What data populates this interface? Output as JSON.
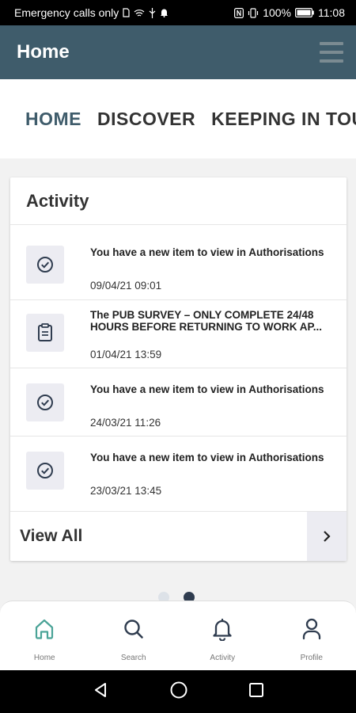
{
  "status_bar": {
    "carrier": "Emergency calls only",
    "battery": "100%",
    "time": "11:08"
  },
  "header": {
    "title": "Home",
    "menu_icon": "hamburger-icon"
  },
  "tabs": [
    {
      "label": "HOME",
      "active": true
    },
    {
      "label": "DISCOVER",
      "active": false
    },
    {
      "label": "KEEPING IN TOU",
      "active": false
    }
  ],
  "activity": {
    "title": "Activity",
    "items": [
      {
        "icon": "check-circle-icon",
        "text": "You have a new item to view in Authorisations",
        "date": "09/04/21 09:01"
      },
      {
        "icon": "clipboard-icon",
        "text": "The PUB SURVEY – ONLY COMPLETE 24/48 HOURS BEFORE RETURNING TO WORK AP...",
        "date": "01/04/21 13:59"
      },
      {
        "icon": "check-circle-icon",
        "text": "You have a new item to view in Authorisations",
        "date": "24/03/21 11:26"
      },
      {
        "icon": "check-circle-icon",
        "text": "You have a new item to view in Authorisations",
        "date": "23/03/21 13:45"
      }
    ],
    "view_all": "View All"
  },
  "pager": {
    "pages": 2,
    "current": 2
  },
  "bottom_nav": [
    {
      "label": "Home",
      "icon": "home-icon",
      "active": true
    },
    {
      "label": "Search",
      "icon": "search-icon",
      "active": false
    },
    {
      "label": "Activity",
      "icon": "bell-icon",
      "active": false
    },
    {
      "label": "Profile",
      "icon": "user-icon",
      "active": false
    }
  ],
  "colors": {
    "header": "#3f5c6b",
    "accent": "#3f5c6b",
    "nav_active": "#4aa397",
    "nav_icon": "#2f3c4f"
  }
}
